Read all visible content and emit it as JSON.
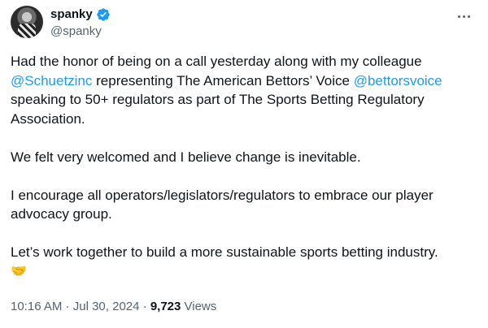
{
  "author": {
    "name": "spanky",
    "handle": "@spanky"
  },
  "tweet": {
    "p1": {
      "t1": "Had the honor of being on a call yesterday along with my colleague",
      "m1": "@Schuetzinc",
      "t2": " representing The American Bettors’ Voice ",
      "m2": "@bettorsvoice",
      "t3": "speaking to 50+ regulators as part of The Sports Betting Regulatory Association."
    },
    "p2": "We felt very welcomed and I believe change is inevitable.",
    "p3": "I encourage all operators/legislators/regulators to embrace our player advocacy group.",
    "p4": "Let’s work together to build a more sustainable sports betting industry.",
    "emoji": "🤝"
  },
  "meta": {
    "time": "10:16 AM",
    "sep1": " · ",
    "date": "Jul 30, 2024",
    "sep2": " · ",
    "views_count": "9,723",
    "views_label": " Views"
  },
  "icons": {
    "verified": "verified-badge-icon",
    "more": "more-options-icon"
  },
  "colors": {
    "accent": "#1d9bf0",
    "muted": "#536471",
    "text": "#0f1419"
  }
}
